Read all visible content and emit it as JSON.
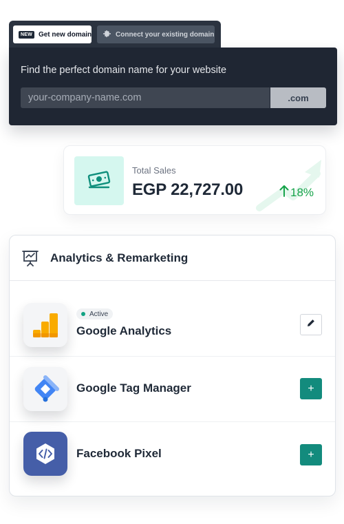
{
  "domain": {
    "tabs": {
      "new_badge": "NEW",
      "get_new": "Get new domain",
      "connect_existing": "Connect your existing domain"
    },
    "title": "Find the perfect domain name for your website",
    "input_placeholder": "your-company-name.com",
    "tld": ".com"
  },
  "sales": {
    "label": "Total Sales",
    "value": "EGP 22,727.00",
    "change": "18%",
    "trend": "up"
  },
  "analytics": {
    "title": "Analytics & Remarketing",
    "items": [
      {
        "name": "Google Analytics",
        "status": "Active",
        "action": "edit"
      },
      {
        "name": "Google Tag Manager",
        "action": "add"
      },
      {
        "name": "Facebook Pixel",
        "action": "add"
      }
    ],
    "add_symbol": "+"
  },
  "colors": {
    "dark_panel": "#1f2633",
    "accent_teal": "#138b7d",
    "success_green": "#16a34a",
    "mint": "#d5f7ef",
    "ga_orange": "#f9ab00",
    "gtm_blue": "#4285f4",
    "facebook_blue": "#455ea8"
  }
}
